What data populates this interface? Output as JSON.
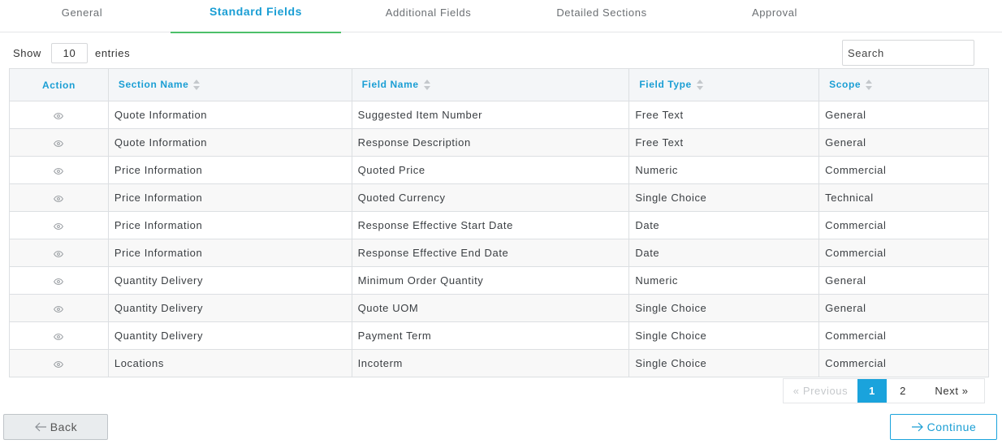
{
  "tabs": [
    {
      "label": "General"
    },
    {
      "label": "Standard Fields",
      "active": true
    },
    {
      "label": "Additional Fields"
    },
    {
      "label": "Detailed Sections"
    },
    {
      "label": "Approval"
    }
  ],
  "length": {
    "show_label": "Show",
    "value": "10",
    "entries_label": "entries"
  },
  "search": {
    "placeholder": "Search"
  },
  "table": {
    "headers": {
      "action": "Action",
      "section": "Section Name",
      "field": "Field Name",
      "type": "Field Type",
      "scope": "Scope"
    },
    "rows": [
      {
        "section": "Quote Information",
        "field": "Suggested Item Number",
        "type": "Free Text",
        "scope": "General"
      },
      {
        "section": "Quote Information",
        "field": "Response Description",
        "type": "Free Text",
        "scope": "General"
      },
      {
        "section": "Price Information",
        "field": "Quoted Price",
        "type": "Numeric",
        "scope": "Commercial"
      },
      {
        "section": "Price Information",
        "field": "Quoted Currency",
        "type": "Single Choice",
        "scope": "Technical"
      },
      {
        "section": "Price Information",
        "field": "Response Effective Start Date",
        "type": "Date",
        "scope": "Commercial"
      },
      {
        "section": "Price Information",
        "field": "Response Effective End Date",
        "type": "Date",
        "scope": "Commercial"
      },
      {
        "section": "Quantity Delivery",
        "field": "Minimum Order Quantity",
        "type": "Numeric",
        "scope": "General"
      },
      {
        "section": "Quantity Delivery",
        "field": "Quote UOM",
        "type": "Single Choice",
        "scope": "General"
      },
      {
        "section": "Quantity Delivery",
        "field": "Payment Term",
        "type": "Single Choice",
        "scope": "Commercial"
      },
      {
        "section": "Locations",
        "field": "Incoterm",
        "type": "Single Choice",
        "scope": "Commercial"
      }
    ]
  },
  "pagination": {
    "previous": "« Previous",
    "page1": "1",
    "page2": "2",
    "next": "Next »"
  },
  "buttons": {
    "back": "Back",
    "continue": "Continue"
  },
  "icons": {
    "row_action": "eye-icon",
    "back": "arrow-left-icon",
    "continue": "arrow-right-icon"
  },
  "colors": {
    "accent": "#1a9ed4",
    "tab_underline": "#4cc06a",
    "page_active": "#1aa3dc"
  }
}
